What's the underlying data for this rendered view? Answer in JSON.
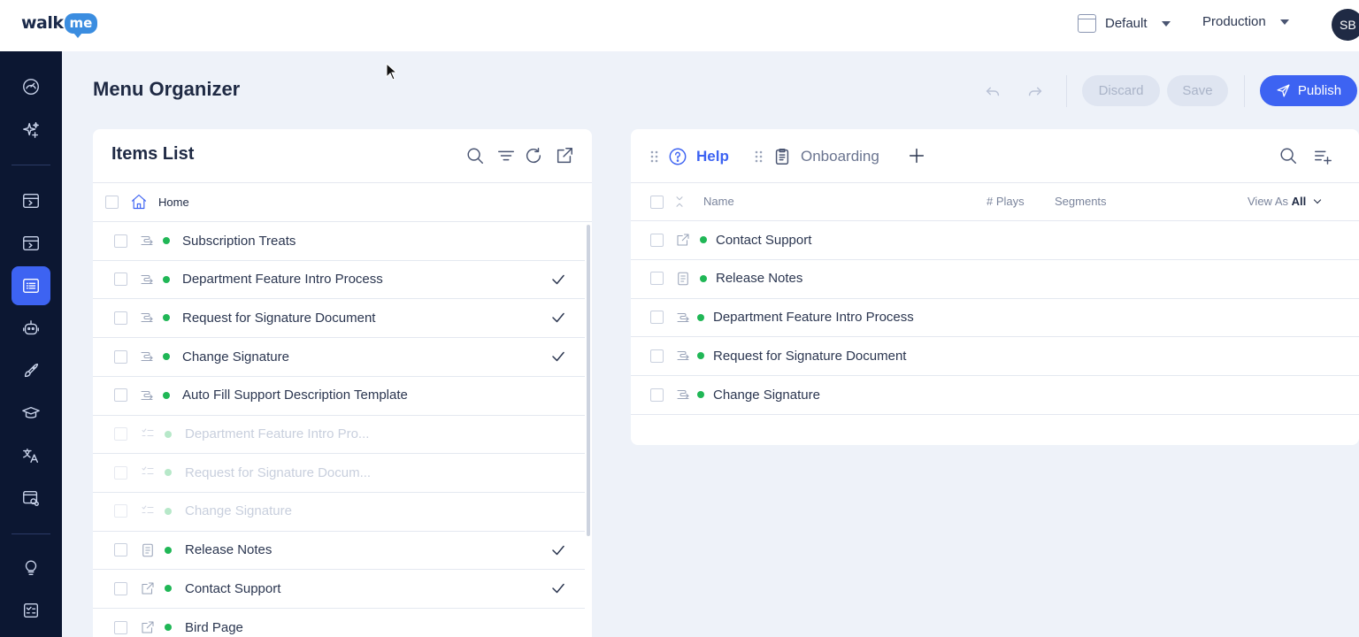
{
  "topbar": {
    "logo_walk": "walk",
    "logo_me": "me",
    "env_default": "Default",
    "env_production": "Production",
    "avatar_initials": "SB"
  },
  "sidebar": {
    "items": [
      {
        "icon": "dashboard-gauge-icon"
      },
      {
        "icon": "ai-sparkle-icon"
      },
      {
        "icon": "smart-walkthru-icon"
      },
      {
        "icon": "walkthru-icon"
      },
      {
        "icon": "menu-organizer-icon",
        "active": true
      },
      {
        "icon": "bot-icon"
      },
      {
        "icon": "launcher-rocket-icon"
      },
      {
        "icon": "training-cap-icon"
      },
      {
        "icon": "translate-icon"
      },
      {
        "icon": "insights-icon"
      },
      {
        "icon": "ideas-bulb-icon"
      },
      {
        "icon": "checklist-icon"
      }
    ]
  },
  "page": {
    "title": "Menu Organizer",
    "discard_label": "Discard",
    "save_label": "Save",
    "publish_label": "Publish"
  },
  "items_list": {
    "title": "Items List",
    "home_label": "Home",
    "rows": [
      {
        "label": "Subscription Treats",
        "icon": "flow-icon",
        "checked": false,
        "faded": false
      },
      {
        "label": "Department Feature Intro Process",
        "icon": "flow-icon",
        "checked": true,
        "faded": false
      },
      {
        "label": "Request for Signature Document",
        "icon": "flow-icon",
        "checked": true,
        "faded": false
      },
      {
        "label": "Change Signature",
        "icon": "flow-icon",
        "checked": true,
        "faded": false
      },
      {
        "label": "Auto Fill Support Description Template",
        "icon": "flow-icon",
        "checked": false,
        "faded": false
      },
      {
        "label": "Department Feature Intro Pro...",
        "icon": "list-icon",
        "checked": false,
        "faded": true
      },
      {
        "label": "Request for Signature Docum...",
        "icon": "list-icon",
        "checked": false,
        "faded": true
      },
      {
        "label": "Change Signature",
        "icon": "list-icon",
        "checked": false,
        "faded": true
      },
      {
        "label": "Release Notes",
        "icon": "document-icon",
        "checked": true,
        "faded": false
      },
      {
        "label": "Contact Support",
        "icon": "external-link-icon",
        "checked": true,
        "faded": false
      },
      {
        "label": "Bird Page",
        "icon": "external-link-icon",
        "checked": false,
        "faded": false
      }
    ]
  },
  "menu": {
    "tabs": [
      {
        "label": "Help",
        "icon": "help-circle-icon",
        "active": true
      },
      {
        "label": "Onboarding",
        "icon": "clipboard-icon",
        "active": false
      }
    ],
    "columns": {
      "name": "Name",
      "plays": "# Plays",
      "segments": "Segments",
      "view_as": "View As",
      "view_as_value": "All"
    },
    "rows": [
      {
        "label": "Contact Support",
        "icon": "external-link-icon"
      },
      {
        "label": "Release Notes",
        "icon": "document-icon"
      },
      {
        "label": "Department Feature Intro Process",
        "icon": "flow-icon"
      },
      {
        "label": "Request for Signature Document",
        "icon": "flow-icon"
      },
      {
        "label": "Change Signature",
        "icon": "flow-icon"
      }
    ]
  },
  "colors": {
    "accent": "#3d63f2",
    "sidebar_bg": "#0c1732",
    "status_green": "#20b756",
    "page_bg": "#eef2f9"
  }
}
